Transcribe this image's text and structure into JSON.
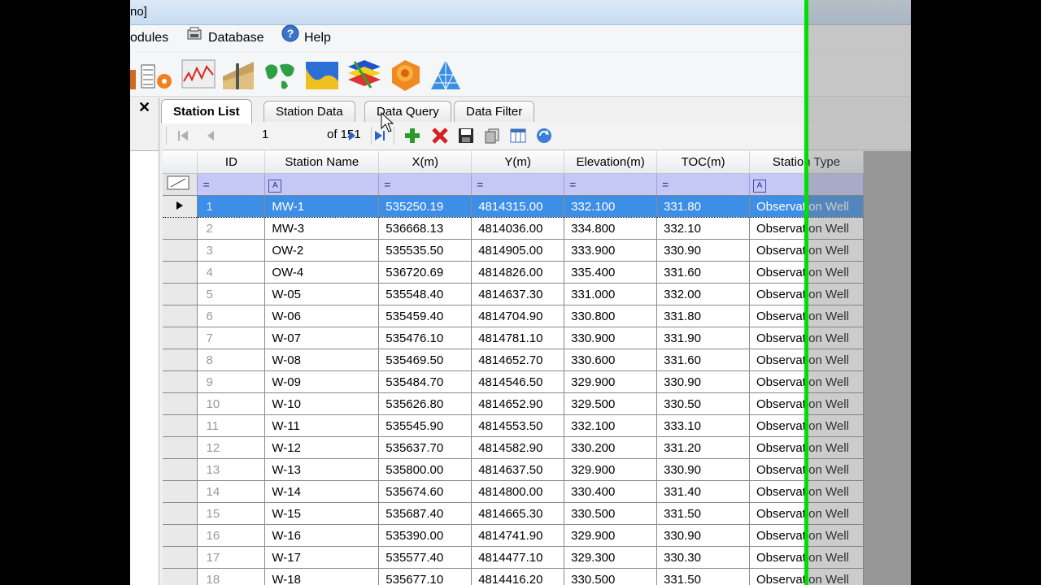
{
  "window": {
    "title_fragment": "no]"
  },
  "menu": {
    "modules_label": "odules",
    "database_label": "Database",
    "help_label": "Help"
  },
  "toolbar": {
    "icons": [
      "borehole-log-icon",
      "time-series-chart-icon",
      "cross-section-icon",
      "map-icon",
      "surface-icon",
      "fence-diagram-icon",
      "3d-solid-icon",
      "tin-mesh-icon"
    ]
  },
  "tabs": [
    {
      "label": "Station List",
      "active": true
    },
    {
      "label": "Station Data",
      "active": false
    },
    {
      "label": "Data Query",
      "active": false
    },
    {
      "label": "Data Filter",
      "active": false
    }
  ],
  "navigator": {
    "current_page": "1",
    "of_label": "of 151"
  },
  "columns": [
    "ID",
    "Station Name",
    "X(m)",
    "Y(m)",
    "Elevation(m)",
    "TOC(m)",
    "Station Type"
  ],
  "filter_row": [
    "=",
    "A",
    "=",
    "=",
    "=",
    "=",
    "A"
  ],
  "rows": [
    {
      "id": "1",
      "name": "MW-1",
      "x": "535250.19",
      "y": "4814315.00",
      "elev": "332.100",
      "toc": "331.80",
      "type": "Observation Well"
    },
    {
      "id": "2",
      "name": "MW-3",
      "x": "536668.13",
      "y": "4814036.00",
      "elev": "334.800",
      "toc": "332.10",
      "type": "Observation Well"
    },
    {
      "id": "3",
      "name": "OW-2",
      "x": "535535.50",
      "y": "4814905.00",
      "elev": "333.900",
      "toc": "330.90",
      "type": "Observation Well"
    },
    {
      "id": "4",
      "name": "OW-4",
      "x": "536720.69",
      "y": "4814826.00",
      "elev": "335.400",
      "toc": "331.60",
      "type": "Observation Well"
    },
    {
      "id": "5",
      "name": "W-05",
      "x": "535548.40",
      "y": "4814637.30",
      "elev": "331.000",
      "toc": "332.00",
      "type": "Observation Well"
    },
    {
      "id": "6",
      "name": "W-06",
      "x": "535459.40",
      "y": "4814704.90",
      "elev": "330.800",
      "toc": "331.80",
      "type": "Observation Well"
    },
    {
      "id": "7",
      "name": "W-07",
      "x": "535476.10",
      "y": "4814781.10",
      "elev": "330.900",
      "toc": "331.90",
      "type": "Observation Well"
    },
    {
      "id": "8",
      "name": "W-08",
      "x": "535469.50",
      "y": "4814652.70",
      "elev": "330.600",
      "toc": "331.60",
      "type": "Observation Well"
    },
    {
      "id": "9",
      "name": "W-09",
      "x": "535484.70",
      "y": "4814546.50",
      "elev": "329.900",
      "toc": "330.90",
      "type": "Observation Well"
    },
    {
      "id": "10",
      "name": "W-10",
      "x": "535626.80",
      "y": "4814652.90",
      "elev": "329.500",
      "toc": "330.50",
      "type": "Observation Well"
    },
    {
      "id": "11",
      "name": "W-11",
      "x": "535545.90",
      "y": "4814553.50",
      "elev": "332.100",
      "toc": "333.10",
      "type": "Observation Well"
    },
    {
      "id": "12",
      "name": "W-12",
      "x": "535637.70",
      "y": "4814582.90",
      "elev": "330.200",
      "toc": "331.20",
      "type": "Observation Well"
    },
    {
      "id": "13",
      "name": "W-13",
      "x": "535800.00",
      "y": "4814637.50",
      "elev": "329.900",
      "toc": "330.90",
      "type": "Observation Well"
    },
    {
      "id": "14",
      "name": "W-14",
      "x": "535674.60",
      "y": "4814800.00",
      "elev": "330.400",
      "toc": "331.40",
      "type": "Observation Well"
    },
    {
      "id": "15",
      "name": "W-15",
      "x": "535687.40",
      "y": "4814665.30",
      "elev": "330.500",
      "toc": "331.50",
      "type": "Observation Well"
    },
    {
      "id": "16",
      "name": "W-16",
      "x": "535390.00",
      "y": "4814741.90",
      "elev": "329.900",
      "toc": "330.90",
      "type": "Observation Well"
    },
    {
      "id": "17",
      "name": "W-17",
      "x": "535577.40",
      "y": "4814477.10",
      "elev": "329.300",
      "toc": "330.30",
      "type": "Observation Well"
    },
    {
      "id": "18",
      "name": "W-18",
      "x": "535677.10",
      "y": "4814416.20",
      "elev": "330.500",
      "toc": "331.50",
      "type": "Observation Well"
    }
  ],
  "selected_row_index": 0,
  "colors": {
    "selection": "#3d8ee6",
    "filter_row": "#c5c8f5",
    "divider_line": "#00e000"
  }
}
